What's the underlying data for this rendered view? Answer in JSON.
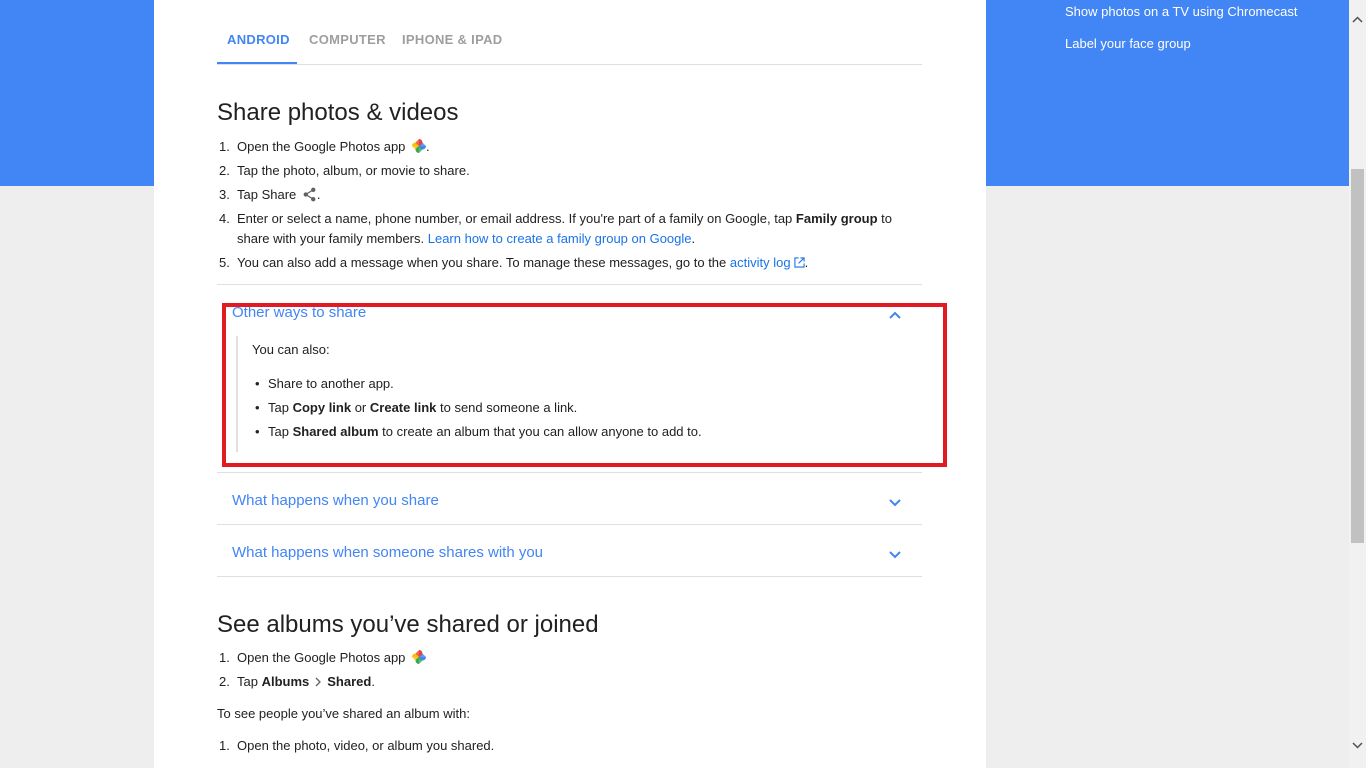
{
  "sidebar": {
    "links": [
      "Show photos on a TV using Chromecast",
      "Label your face group"
    ]
  },
  "tabs": [
    {
      "label": "ANDROID",
      "active": true
    },
    {
      "label": "COMPUTER",
      "active": false
    },
    {
      "label": "IPHONE & IPAD",
      "active": false
    }
  ],
  "section1": {
    "title": "Share photos & videos",
    "step1": {
      "num": "1.",
      "text": "Open the Google Photos app",
      "after": "."
    },
    "step2": {
      "num": "2.",
      "text": "Tap the photo, album, or movie to share."
    },
    "step3": {
      "num": "3.",
      "text": "Tap Share",
      "after": "."
    },
    "step4": {
      "num": "4.",
      "text1": "Enter or select a name, phone number, or email address. If you're part of a family on Google, tap ",
      "bold": "Family group",
      "text2": " to share with your family members. ",
      "link": "Learn how to create a family group on Google",
      "after": "."
    },
    "step5": {
      "num": "5.",
      "text": "You can also add a message when you share. To manage these messages, go to the ",
      "link": "activity log",
      "after": "."
    }
  },
  "accordion": {
    "item1": {
      "title": "Other ways to share",
      "intro": "You can also:",
      "b1": "Share to another app.",
      "b2": {
        "t1": "Tap ",
        "bold1": "Copy link",
        "t2": " or ",
        "bold2": "Create link",
        "t3": " to send someone a link."
      },
      "b3": {
        "t1": "Tap ",
        "bold1": "Shared album",
        "t2": " to create an album that you can allow anyone to add to."
      }
    },
    "item2": {
      "title": "What happens when you share"
    },
    "item3": {
      "title": "What happens when someone shares with you"
    }
  },
  "section2": {
    "title": "See albums you’ve shared or joined",
    "step1": {
      "num": "1.",
      "text": "Open the Google Photos app"
    },
    "step2": {
      "num": "2.",
      "t1": "Tap ",
      "bold1": "Albums",
      "bold2": "Shared",
      "after": "."
    },
    "para": "To see people you’ve shared an album with:",
    "step3": {
      "num": "1.",
      "text": "Open the photo, video, or album you shared."
    }
  },
  "colors": {
    "accent": "#4285f4",
    "highlight": "#e21a23",
    "link": "#1a73e8"
  }
}
